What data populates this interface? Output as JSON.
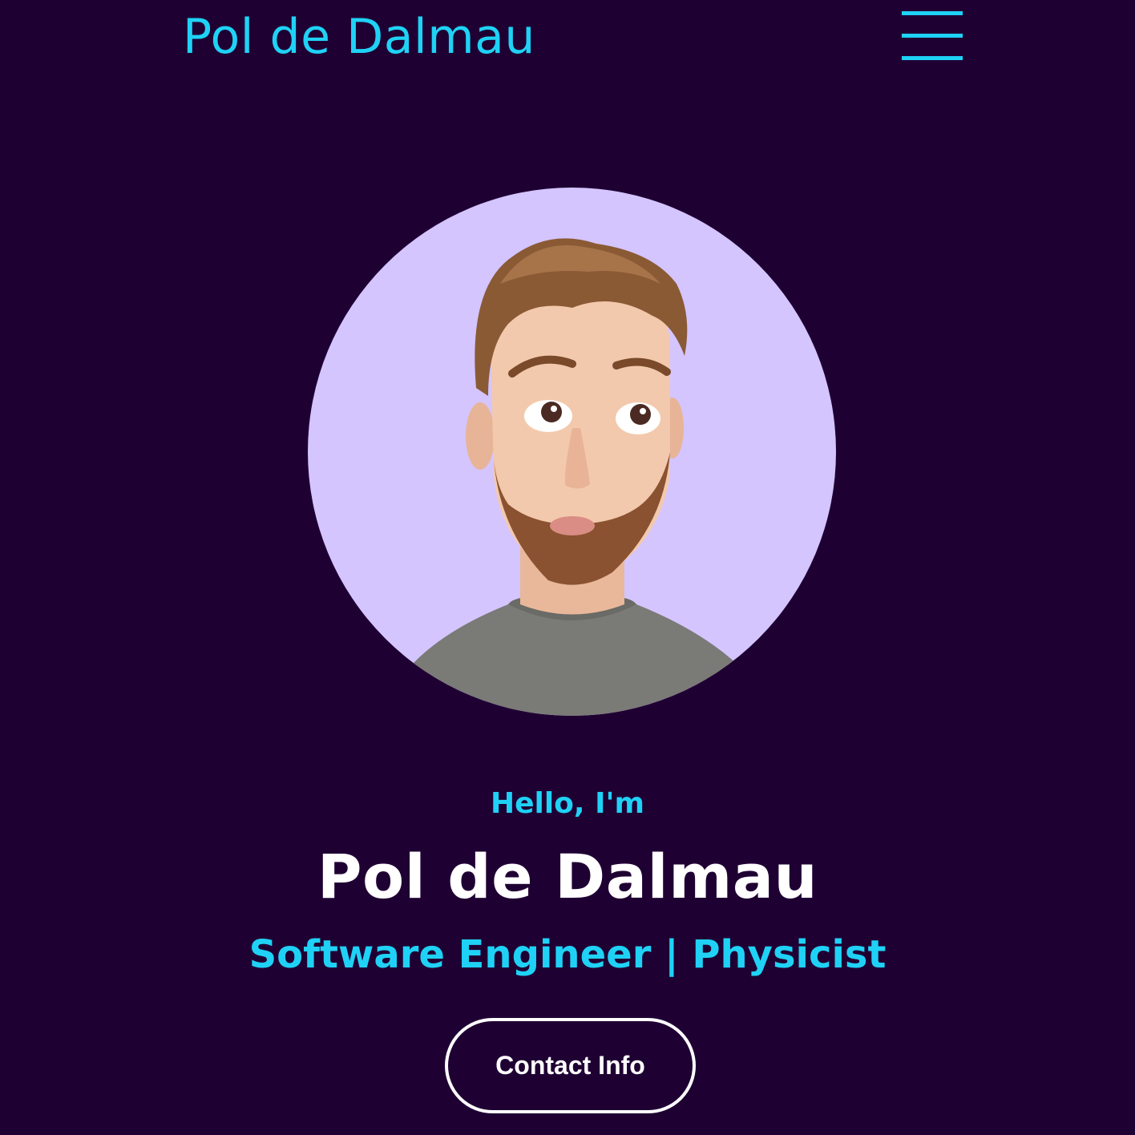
{
  "header": {
    "brand": "Pol de Dalmau",
    "menu_icon": "hamburger-menu-icon"
  },
  "hero": {
    "greeting": "Hello, I'm",
    "name": "Pol de Dalmau",
    "role": "Software Engineer | Physicist",
    "contact_button_label": "Contact Info",
    "avatar_alt": "avatar"
  },
  "colors": {
    "background": "#1f0033",
    "accent": "#1fd2f5",
    "avatar_background": "#d4c5ff",
    "text": "#ffffff"
  }
}
